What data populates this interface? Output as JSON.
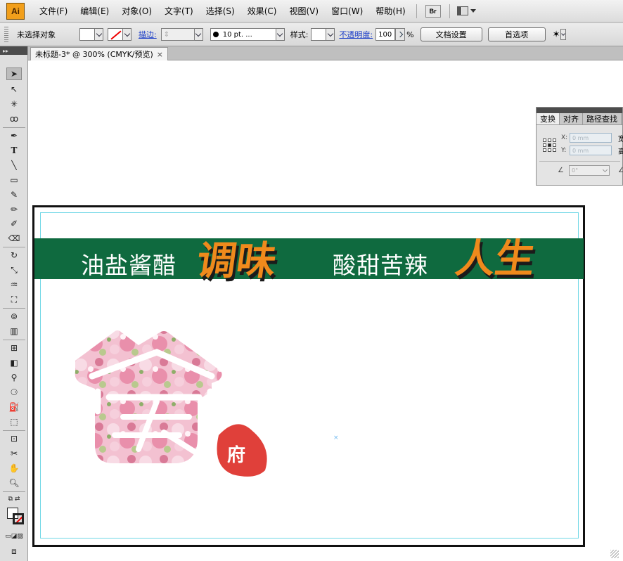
{
  "app": {
    "logo": "Ai"
  },
  "menu": [
    "文件(F)",
    "编辑(E)",
    "对象(O)",
    "文字(T)",
    "选择(S)",
    "效果(C)",
    "视图(V)",
    "窗口(W)",
    "帮助(H)"
  ],
  "menubar_extra": {
    "bridge_label": "Br",
    "workspace_icon": "workspace-grid-icon"
  },
  "controlbar": {
    "selection_status": "未选择对象",
    "stroke_label": "描边:",
    "brush_value": "10 pt. ...",
    "style_label": "样式:",
    "opacity_label": "不透明度:",
    "opacity_value": "100",
    "opacity_unit": "%",
    "doc_setup_button": "文档设置",
    "preferences_button": "首选项"
  },
  "document_tab": {
    "title": "未标题-3* @ 300% (CMYK/预览)",
    "close": "×"
  },
  "artwork": {
    "banner_text_1": "油盐酱醋",
    "banner_text_2": "调味",
    "banner_text_3": "酸甜苦辣",
    "banner_text_4": "人生",
    "logo_badge_char": "府",
    "banner_color": "#0f6a3f",
    "accent_color": "#ef8a1c",
    "badge_color": "#e0403a"
  },
  "transform_panel": {
    "tabs": [
      "变换",
      "对齐",
      "路径查找"
    ],
    "x_label": "X:",
    "x_value": "0 mm",
    "y_label": "Y:",
    "y_value": "0 mm",
    "w_label": "宽",
    "h_label": "高",
    "angle_value": "0°"
  },
  "colors": {
    "ui_gray": "#d4d4d4",
    "link_blue": "#1a3cc8",
    "guide_cyan": "#6fd7e6"
  }
}
